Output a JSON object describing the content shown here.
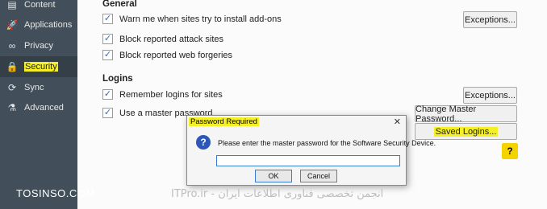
{
  "sidebar": {
    "items": [
      {
        "label": "Content",
        "icon": "document-icon"
      },
      {
        "label": "Applications",
        "icon": "rocket-icon"
      },
      {
        "label": "Privacy",
        "icon": "mask-icon"
      },
      {
        "label": "Security",
        "icon": "lock-icon",
        "active": true
      },
      {
        "label": "Sync",
        "icon": "sync-icon"
      },
      {
        "label": "Advanced",
        "icon": "wizard-icon"
      }
    ]
  },
  "general": {
    "heading": "General",
    "warn_addons": "Warn me when sites try to install add-ons",
    "block_attack": "Block reported attack sites",
    "block_forgeries": "Block reported web forgeries",
    "exceptions_label": "Exceptions..."
  },
  "logins": {
    "heading": "Logins",
    "remember": "Remember logins for sites",
    "master_password": "Use a master password",
    "exceptions_label": "Exceptions...",
    "change_master_label": "Change Master Password...",
    "saved_logins_label": "Saved Logins...",
    "help_label": "?"
  },
  "dialog": {
    "title": "Password Required",
    "close": "✕",
    "icon": "?",
    "message": "Please enter the master password for the Software Security Device.",
    "input_value": "",
    "ok_label": "OK",
    "cancel_label": "Cancel"
  },
  "watermark": {
    "left": "TOSINSO.COM",
    "right": "ITPro.ir - انجمن تخصصی فناوری اطلاعات ایران"
  },
  "colors": {
    "highlight": "#f5ef27",
    "sidebar_bg": "#424f5a",
    "accent": "#2a6db5"
  }
}
